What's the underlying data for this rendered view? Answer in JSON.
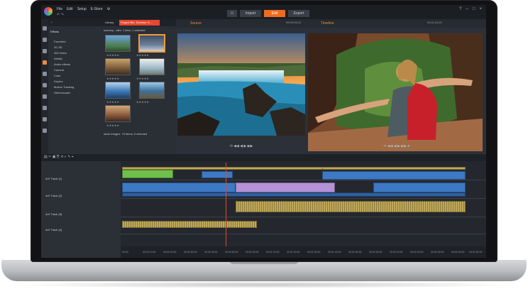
{
  "app": {
    "menu": [
      "File",
      "Edit",
      "Setup",
      "E-Store"
    ],
    "tabs": {
      "import": "Import",
      "edit": "Edit",
      "export": "Export"
    }
  },
  "library": {
    "tab_label": "Library",
    "project_tab": "Project Bin: Summer H...",
    "categories": [
      {
        "label": "Effects"
      },
      {
        "label": "Favorites"
      },
      {
        "label": "2D-3D"
      },
      {
        "label": "360 Video"
      },
      {
        "label": "Artistic"
      },
      {
        "label": "Audio effects"
      },
      {
        "label": "Camera"
      },
      {
        "label": "Color"
      },
      {
        "label": "Keyers"
      },
      {
        "label": "Motion Tracking"
      },
      {
        "label": "Stereoscopic"
      }
    ],
    "bin_top": "scenery - alex",
    "bin_top_info": "1 item, 1 selected",
    "bin_bottom": "stock images",
    "bin_bottom_info": "70 items, 0 selected",
    "stars": "★★★★★"
  },
  "source": {
    "title": "Source",
    "timecode": "00:00:03.03"
  },
  "timeline_preview": {
    "title": "Timeline",
    "timecode": "00:01:03.21"
  },
  "tracks": [
    {
      "name": "A/V Track (1)"
    },
    {
      "name": "A/V Track (2)"
    },
    {
      "name": "A/V Track (3)"
    },
    {
      "name": "A/V Track (4)"
    }
  ],
  "ruler_ticks": [
    "00:00",
    "00:00:10:00",
    "00:00:20:00",
    "00:00:30:00",
    "00:00:40:00",
    "00:00:50:00",
    "00:01:00:00",
    "00:01:10:00",
    "00:01:20:00",
    "00:01:30:00",
    "00:01:40:00",
    "00:01:50:00",
    "00:02:00:00",
    "00:02:10:00",
    "00:02:20:00",
    "00:02:30:00",
    "00:02:40:00",
    "00:02:50:00"
  ],
  "colors": {
    "accent": "#ef6b1e",
    "project_tab": "#e5472f",
    "clip_blue": "#3d79c4",
    "clip_purple": "#b592d6",
    "clip_green": "#6ec04a",
    "clip_audio": "#bfa85a"
  }
}
